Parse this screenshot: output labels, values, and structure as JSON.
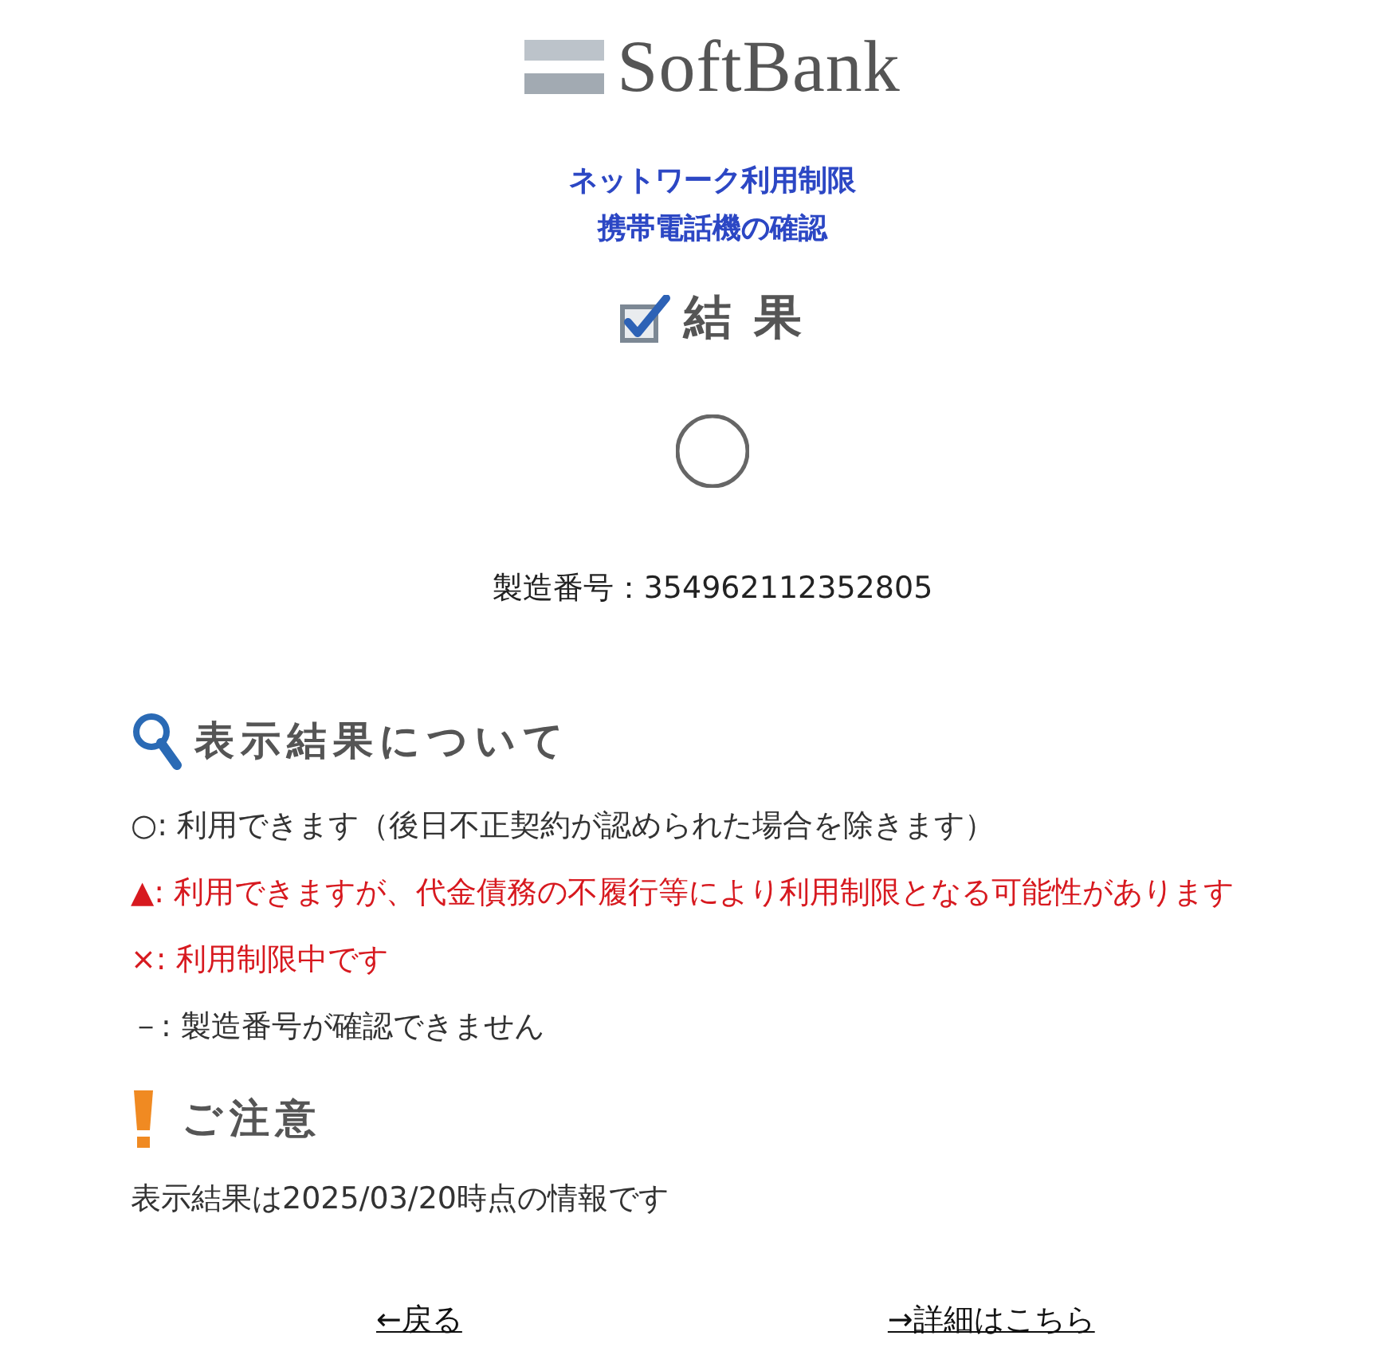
{
  "logo": {
    "text": "SoftBank"
  },
  "title_lines": [
    "ネットワーク利用制限",
    "携帯電話機の確認"
  ],
  "result": {
    "heading": "結 果",
    "kind": "circle"
  },
  "serial": "製造番号：354962112352805",
  "legend": {
    "heading": "表示結果について",
    "items": [
      {
        "text": "○: 利用できます（後日不正契約が認められた場合を除きます）",
        "color": "#333333"
      },
      {
        "text": "▲: 利用できますが、代金債務の不履行等により利用制限となる可能性があります",
        "color": "#d7191f"
      },
      {
        "text": "×: 利用制限中です",
        "color": "#d7191f"
      },
      {
        "text": "－: 製造番号が確認できません",
        "color": "#333333"
      }
    ]
  },
  "notice": {
    "heading": "ご注意",
    "text": "表示結果は2025/03/20時点の情報です"
  },
  "links": [
    {
      "label": "←戻る"
    },
    {
      "label": "→詳細はこちら"
    }
  ]
}
